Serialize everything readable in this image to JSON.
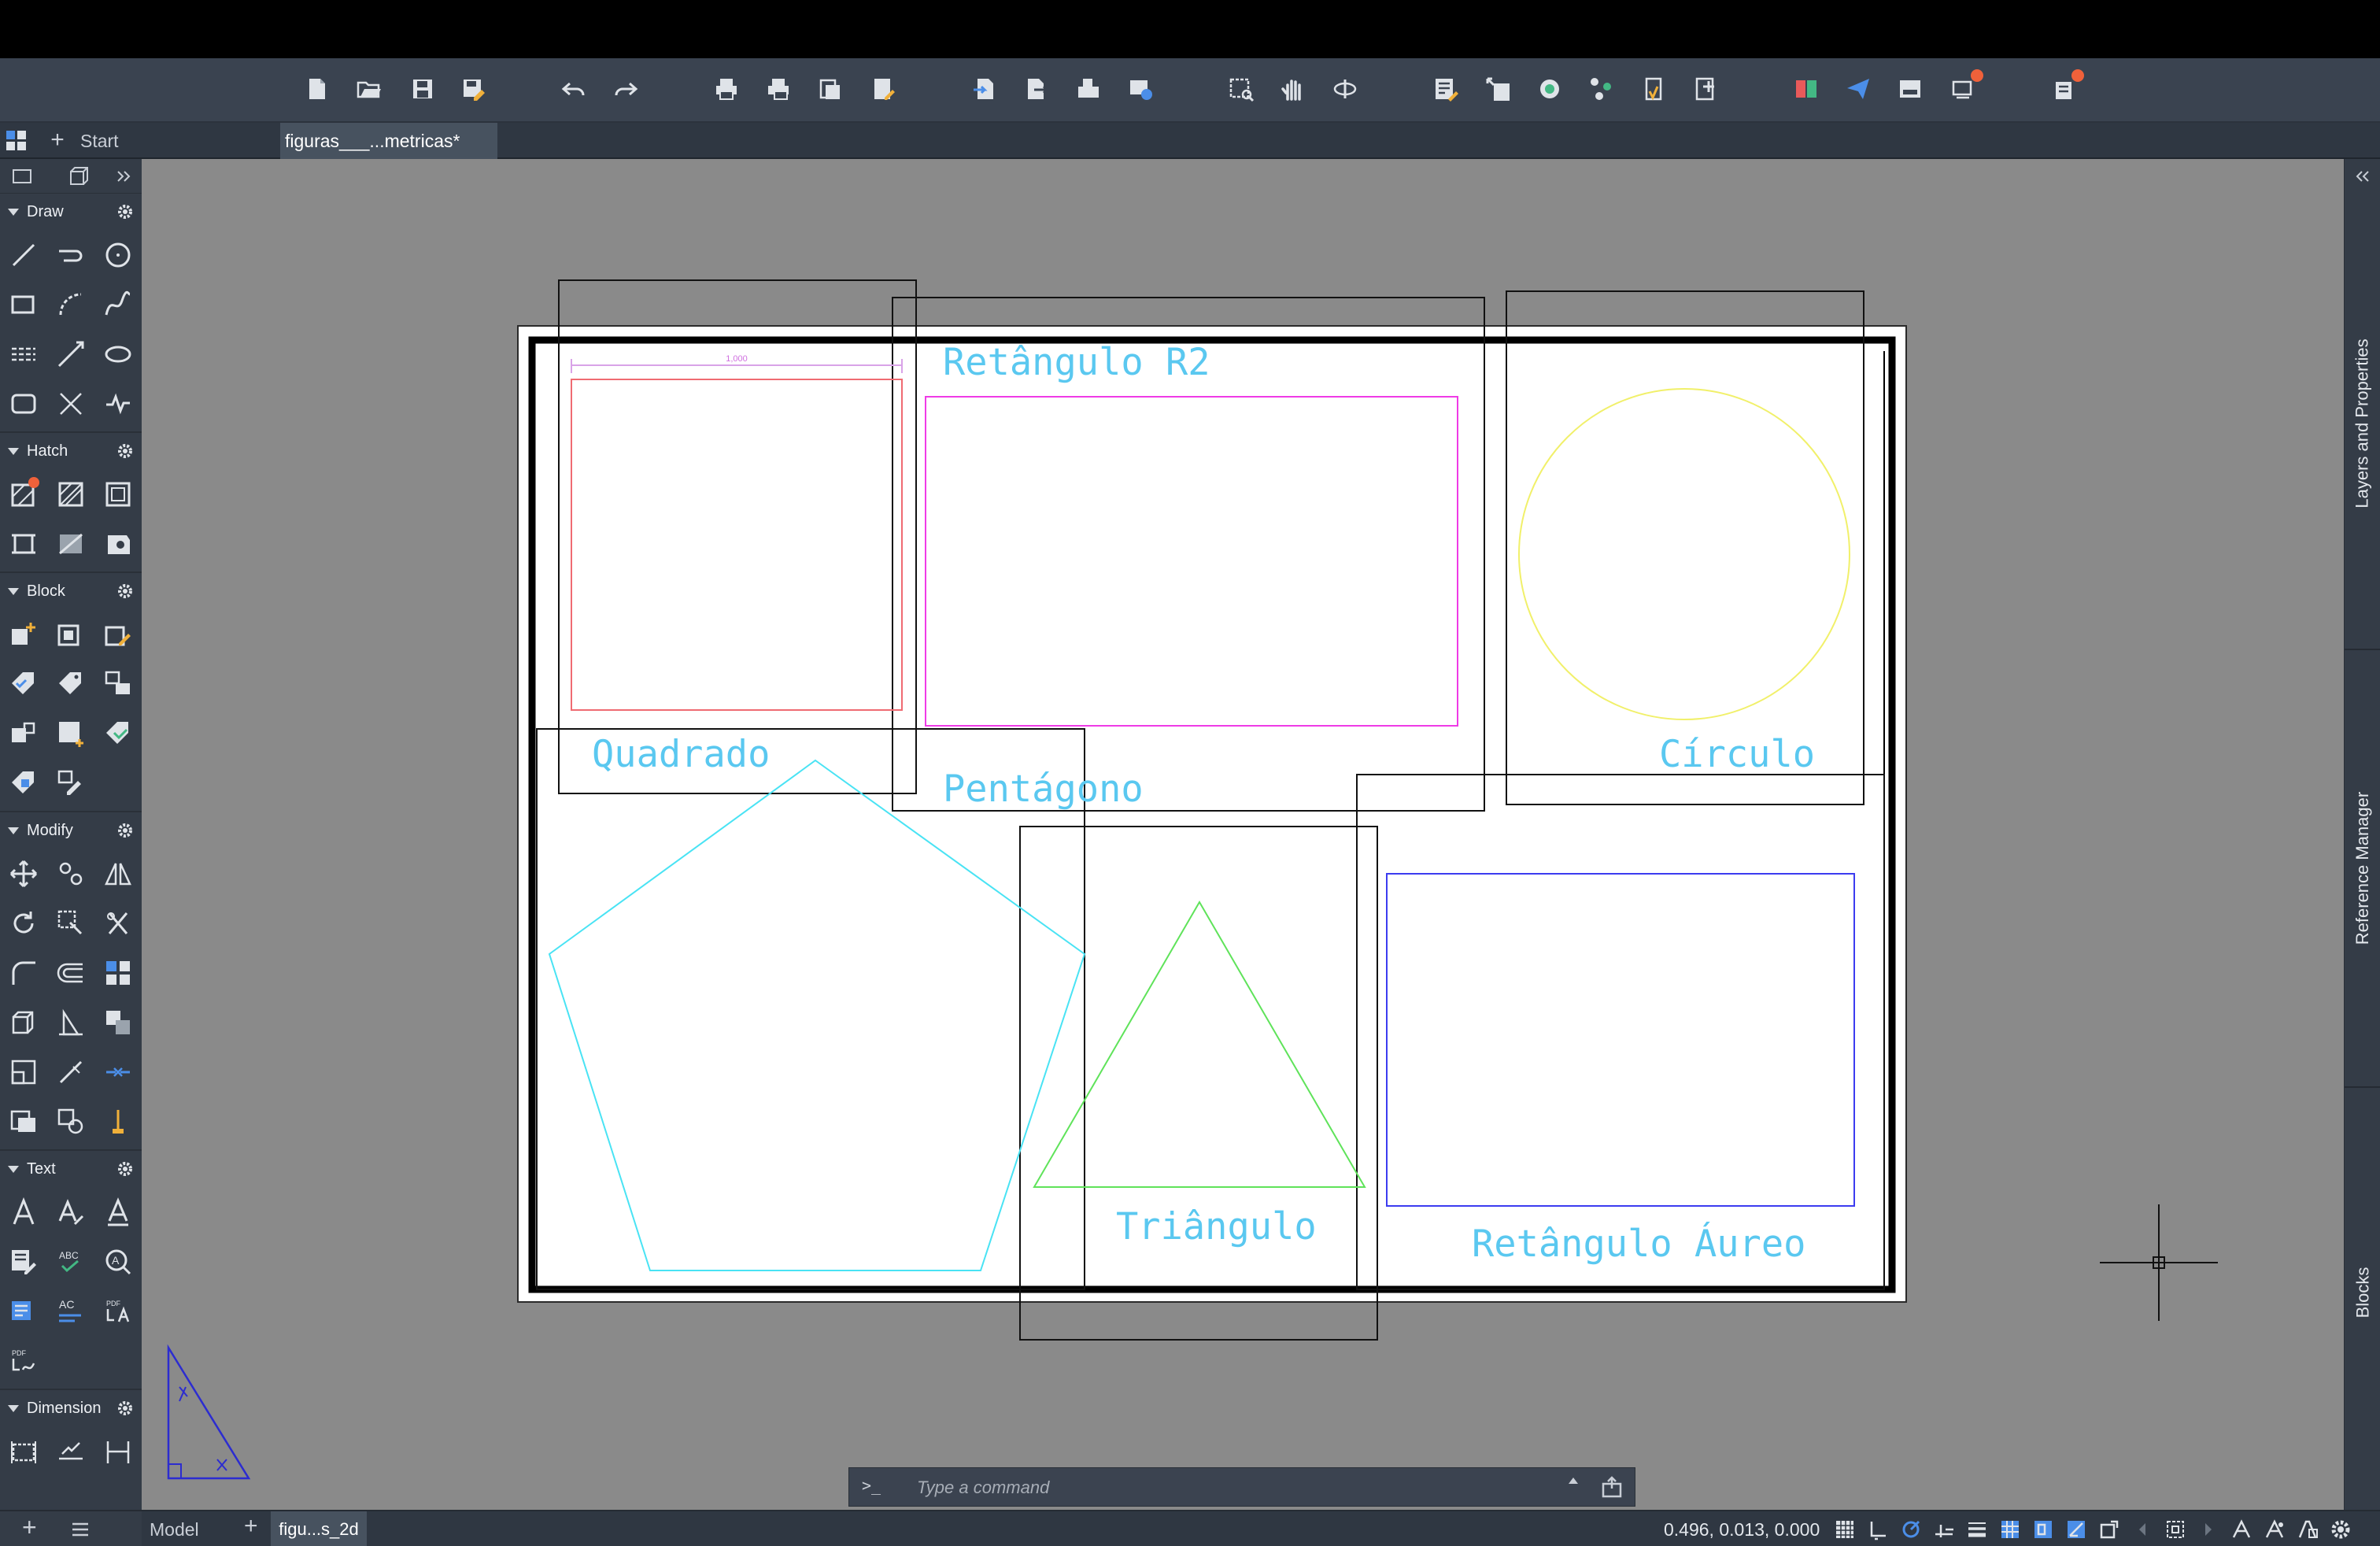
{
  "tabs": {
    "start_label": "Start",
    "document_label": "figuras___...metricas*"
  },
  "panels": {
    "draw": "Draw",
    "hatch": "Hatch",
    "block": "Block",
    "modify": "Modify",
    "text": "Text",
    "dimension": "Dimension"
  },
  "drawing": {
    "labels": {
      "quadrado": "Quadrado",
      "retangulo_r2": "Retângulo R2",
      "circulo": "Círculo",
      "pentagono": "Pentágono",
      "triangulo": "Triângulo",
      "retangulo_aureo": "Retângulo Áureo"
    },
    "dimension_text": "1,000",
    "colors": {
      "quadrado": "#ef6b72",
      "retangulo_r2": "#ef3be6",
      "circulo": "#f1f06a",
      "pentagono": "#49e3f4",
      "triangulo": "#5fe35a",
      "retangulo_aureo": "#3c3cf0",
      "label": "#5ac8f0",
      "frame": "#000000"
    }
  },
  "right_tabs": {
    "layers": "Layers and Properties",
    "reference": "Reference Manager",
    "blocks": "Blocks"
  },
  "status": {
    "model_tab": "Model",
    "layout_tab": "figu...s_2d",
    "coordinates": "0.496, 0.013, 0.000"
  },
  "command": {
    "prompt": ">_",
    "placeholder": "Type a command"
  }
}
